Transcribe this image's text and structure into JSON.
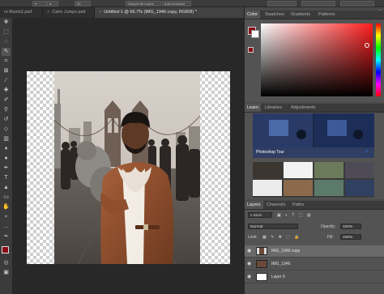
{
  "options_bar": {
    "zoom_value": "30",
    "btn_sample": "Sample All Layers",
    "btn_enhance": "Auto-Enhance"
  },
  "tabs": [
    {
      "label": "ro Rams2.psd",
      "close": "×"
    },
    {
      "label": "Cairo Jumps.psd",
      "close": "×"
    },
    {
      "label": "Untitled-1 @ 66.7% (IMG_1946 copy, RGB/8) *",
      "close": "×"
    }
  ],
  "color_panel": {
    "tabs": [
      "Color",
      "Swatches",
      "Gradients",
      "Patterns"
    ],
    "foreground": "#8b0a14",
    "background": "#ffffff",
    "hue_color": "#ff1e1e"
  },
  "learn_panel": {
    "tabs": [
      "Learn",
      "Libraries",
      "Adjustments"
    ],
    "tour_label": "Photoshop Tour"
  },
  "layers_panel": {
    "tabs": [
      "Layers",
      "Channels",
      "Paths"
    ],
    "kind_label": "Kind",
    "blend_mode": "Normal",
    "opacity_label": "Opacity:",
    "opacity_value": "100%",
    "lock_label": "Lock:",
    "fill_label": "Fill:",
    "fill_value": "100%",
    "layers": [
      {
        "name": "IMG_1946 copy",
        "selected": true
      },
      {
        "name": "IMG_1946",
        "selected": false
      },
      {
        "name": "Layer 0",
        "selected": false
      }
    ]
  },
  "icons": {
    "collapse": "»",
    "visibility": "eye-icon",
    "checkmark": "✓"
  },
  "colors": {
    "accent": "#2d8ceb",
    "panel_bg": "#535353",
    "canvas_bg": "#282828"
  }
}
